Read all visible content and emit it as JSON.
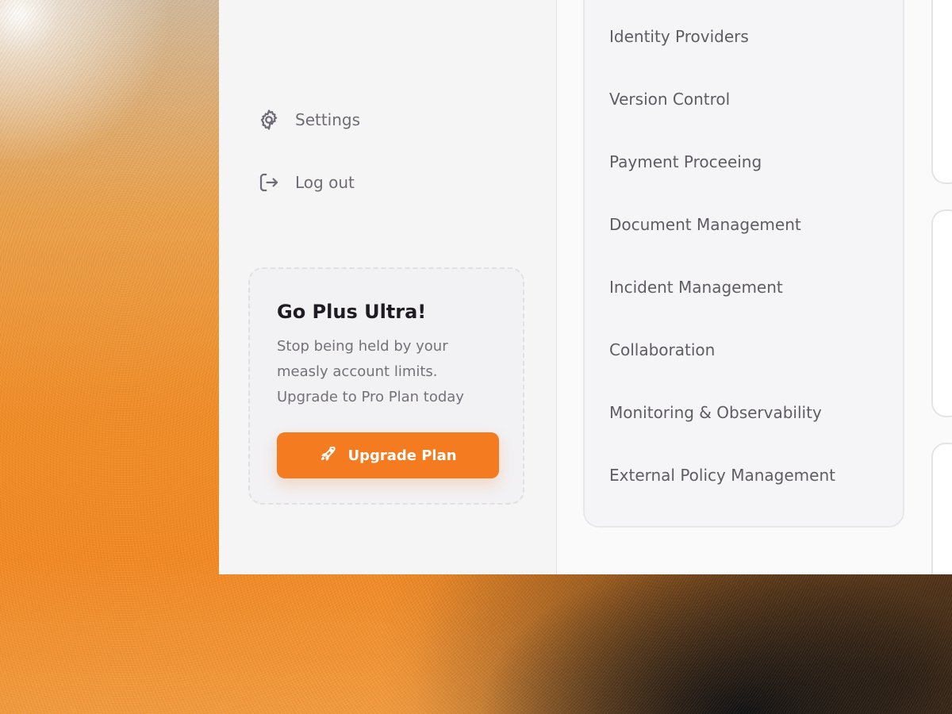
{
  "sidebar": {
    "nav_items": [
      {
        "label": "Settings",
        "icon": "gear-icon"
      },
      {
        "label": "Log out",
        "icon": "logout-icon"
      }
    ]
  },
  "upgrade_card": {
    "title": "Go Plus Ultra!",
    "text": "Stop being held by your measly account limits. Upgrade to Pro Plan today",
    "button_label": "Upgrade Plan",
    "button_icon": "rocket-icon",
    "button_color": "#f47b1f"
  },
  "menu": {
    "items": [
      "Identity Providers",
      "Version Control",
      "Payment Proceeing",
      "Document Management",
      "Incident Management",
      "Collaboration",
      "Monitoring & Observability",
      "External Policy Management"
    ]
  },
  "colors": {
    "accent": "#f47b1f",
    "sidebar_bg": "#f6f5f6",
    "text_muted": "#6f6c75",
    "heading": "#1e1c22"
  }
}
